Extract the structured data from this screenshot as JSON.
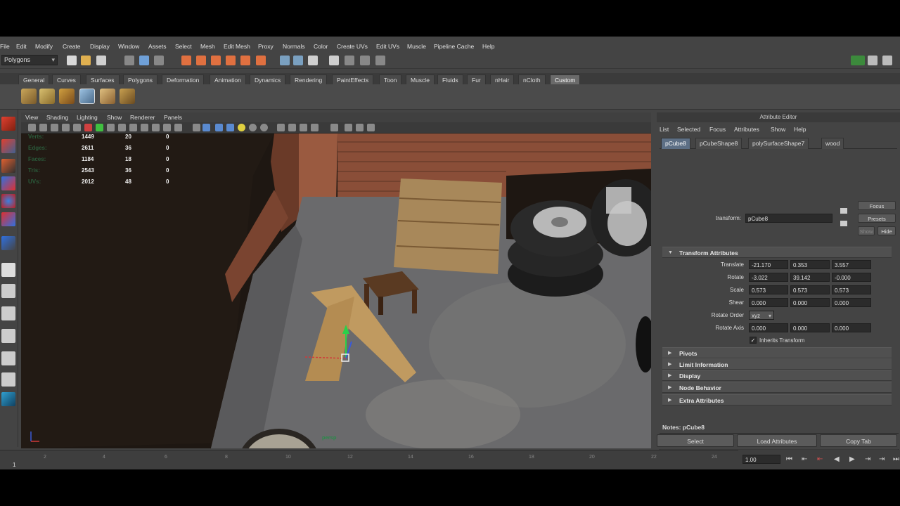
{
  "menus": [
    "File",
    "Edit",
    "Modify",
    "Create",
    "Display",
    "Window",
    "Assets",
    "Select",
    "Mesh",
    "Edit Mesh",
    "Proxy",
    "Normals",
    "Color",
    "Create UVs",
    "Edit UVs",
    "Muscle",
    "Pipeline Cache",
    "Help"
  ],
  "status_line": {
    "mode": "Polygons"
  },
  "shelf_tabs": [
    "General",
    "Curves",
    "Surfaces",
    "Polygons",
    "Deformation",
    "Animation",
    "Dynamics",
    "Rendering",
    "PaintEffects",
    "Toon",
    "Muscle",
    "Fluids",
    "Fur",
    "nHair",
    "nCloth",
    "Custom"
  ],
  "shelf_tabs_active": "Custom",
  "viewport": {
    "menus": [
      "View",
      "Shading",
      "Lighting",
      "Show",
      "Renderer",
      "Panels"
    ],
    "camera_label": "persp",
    "hud": [
      {
        "label": "Verts:",
        "a": "1449",
        "b": "20",
        "c": "0"
      },
      {
        "label": "Edges:",
        "a": "2611",
        "b": "36",
        "c": "0"
      },
      {
        "label": "Faces:",
        "a": "1184",
        "b": "18",
        "c": "0"
      },
      {
        "label": "Tris:",
        "a": "2543",
        "b": "36",
        "c": "0"
      },
      {
        "label": "UVs:",
        "a": "2012",
        "b": "48",
        "c": "0"
      }
    ]
  },
  "attribute_editor": {
    "title": "Attribute Editor",
    "menus": [
      "List",
      "Selected",
      "Focus",
      "Attributes",
      "Show",
      "Help"
    ],
    "tabs": [
      "pCube8",
      "pCubeShape8",
      "polySurfaceShape7",
      "wood"
    ],
    "active_tab": "pCube8",
    "transform_label": "transform:",
    "transform_value": "pCube8",
    "buttons": {
      "focus": "Focus",
      "presets": "Presets",
      "show": "Show",
      "hide": "Hide"
    },
    "section_title": "Transform Attributes",
    "rows": [
      {
        "label": "Translate",
        "values": [
          "-21.170",
          "0.353",
          "3.557"
        ]
      },
      {
        "label": "Rotate",
        "values": [
          "-3.022",
          "39.142",
          "-0.000"
        ]
      },
      {
        "label": "Scale",
        "values": [
          "0.573",
          "0.573",
          "0.573"
        ]
      },
      {
        "label": "Shear",
        "values": [
          "0.000",
          "0.000",
          "0.000"
        ]
      }
    ],
    "rotate_order_label": "Rotate Order",
    "rotate_order_value": "xyz",
    "rotate_axis_label": "Rotate Axis",
    "rotate_axis_values": [
      "0.000",
      "0.000",
      "0.000"
    ],
    "inherits_transform": "Inherits Transform",
    "inherits_checked": true,
    "collapsed_sections": [
      "Pivots",
      "Limit Information",
      "Display",
      "Node Behavior",
      "Extra Attributes"
    ],
    "notes_label": "Notes:  pCube8",
    "bottom_buttons": [
      "Select",
      "Load Attributes",
      "Copy Tab"
    ]
  },
  "timeline": {
    "ticks": [
      "1",
      "2",
      "4",
      "6",
      "8",
      "10",
      "12",
      "14",
      "16",
      "18",
      "20",
      "22",
      "24"
    ],
    "current_frame": "1",
    "current_time_field": "1.00"
  },
  "colors": {
    "panel_bg": "#444444",
    "active_tab": "#5d6f85",
    "hud_text": "#f2f2f2"
  }
}
